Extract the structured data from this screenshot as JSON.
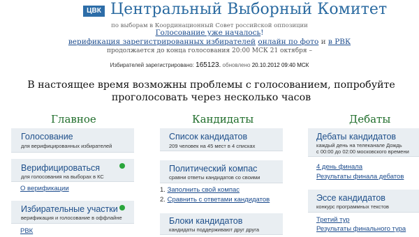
{
  "header": {
    "logo": "ЦВК",
    "title": "Центральный Выборный Комитет",
    "subtitle": "по выборам в Координационный Совет российской оппозиции",
    "voting_started_link": "Голосование уже началось",
    "voting_started_suffix": "!",
    "verification_link": "верификация зарегистрированных избирателей",
    "verification_mid": " ",
    "online_photo_link": "онлайн по фото",
    "and_text": " и ",
    "rvk_link": "в РВК",
    "countdown": "продолжается до конца голосования 20:00 МСК 21 октября –"
  },
  "voters": {
    "label": "Избирателей зарегистрировано:",
    "count": "165123.",
    "updated_label": "обновлено",
    "updated_date": "20.10.2012 09:40 МСК"
  },
  "warning": "В настоящее время возможны проблемы с голосованием, попробуйте проголосовать через несколько часов",
  "columns": {
    "main": {
      "heading": "Главное",
      "card_voting": {
        "title": "Голосование",
        "desc": "для верифицированных избирателей"
      },
      "card_verify": {
        "title": "Верифицироваться",
        "desc": "для голосования на выборах в КС"
      },
      "about_verify_link": "О верификации",
      "card_stations": {
        "title": "Избирательные участки",
        "desc": "верификация и голосование в оффлайне"
      },
      "rvk_link": "РВК"
    },
    "candidates": {
      "heading": "Кандидаты",
      "card_list": {
        "title": "Список кандидатов",
        "desc": "209 человек на 45 мест в 4 списках"
      },
      "card_compass": {
        "title": "Политический компас",
        "desc": "сравни ответы кандидатов со своими"
      },
      "step1_num": "1.",
      "step1_link": "Заполнить свой компас",
      "step2_num": "2.",
      "step2_link": "Сравнить с ответами кандидатов",
      "card_blocks": {
        "title": "Блоки кандидатов",
        "desc": "кандидаты поддерживают друг друга"
      }
    },
    "debates": {
      "heading": "Дебаты",
      "card_debates": {
        "title": "Дебаты кандидатов",
        "desc1": "каждый день на телеканале Дождь",
        "desc2": "с 00:00 до 02:00 московского времени"
      },
      "final_day_link": "4 день финала",
      "final_results_link": "Результаты финала дебатов",
      "card_essay": {
        "title": "Эссе кандидатов",
        "desc": "конкурс программных текстов"
      },
      "round3_link": "Третий тур",
      "final_round_results_link": "Результаты финального тура"
    }
  },
  "colors": {
    "title_blue": "#2a6aa0",
    "link_blue": "#1a4a8c",
    "heading_green": "#1f6d2a",
    "card_bg": "#e9eef2",
    "status_dot": "#2aa63c"
  }
}
